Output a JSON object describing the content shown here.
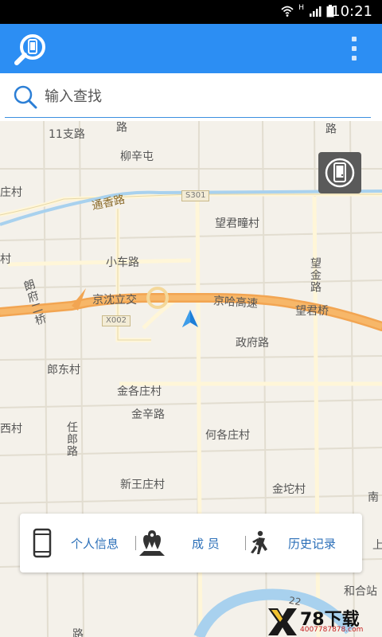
{
  "status_bar": {
    "time": "10:21",
    "network": "H"
  },
  "search": {
    "placeholder": "输入查找"
  },
  "map": {
    "labels": {
      "l1": "11支路",
      "l2": "柳辛屯",
      "l3": "庄村",
      "l4": "通香路",
      "l5": "S301",
      "l6": "望君疃村",
      "l7": "小车路",
      "l8": "望金路",
      "l9": "京沈立交",
      "l10": "京哈高速",
      "l11": "望君桥",
      "l12": "朗府二桥",
      "l13": "X002",
      "l14": "政府路",
      "l15": "郎东村",
      "l16": "金各庄村",
      "l17": "金辛路",
      "l18": "何各庄村",
      "l19": "西村",
      "l20": "任郎路",
      "l21": "新王庄村",
      "l22": "金坨村",
      "l23": "南",
      "l24": "上",
      "l25": "和合站",
      "l26": "路",
      "l27": "村",
      "l28": "路",
      "l29": "路",
      "l30": "22"
    }
  },
  "bottom_panel": {
    "personal_info": "个人信息",
    "members": "成 员",
    "history": "历史记录"
  },
  "watermark": {
    "text": "78下载",
    "sub": "4007787878.com"
  }
}
